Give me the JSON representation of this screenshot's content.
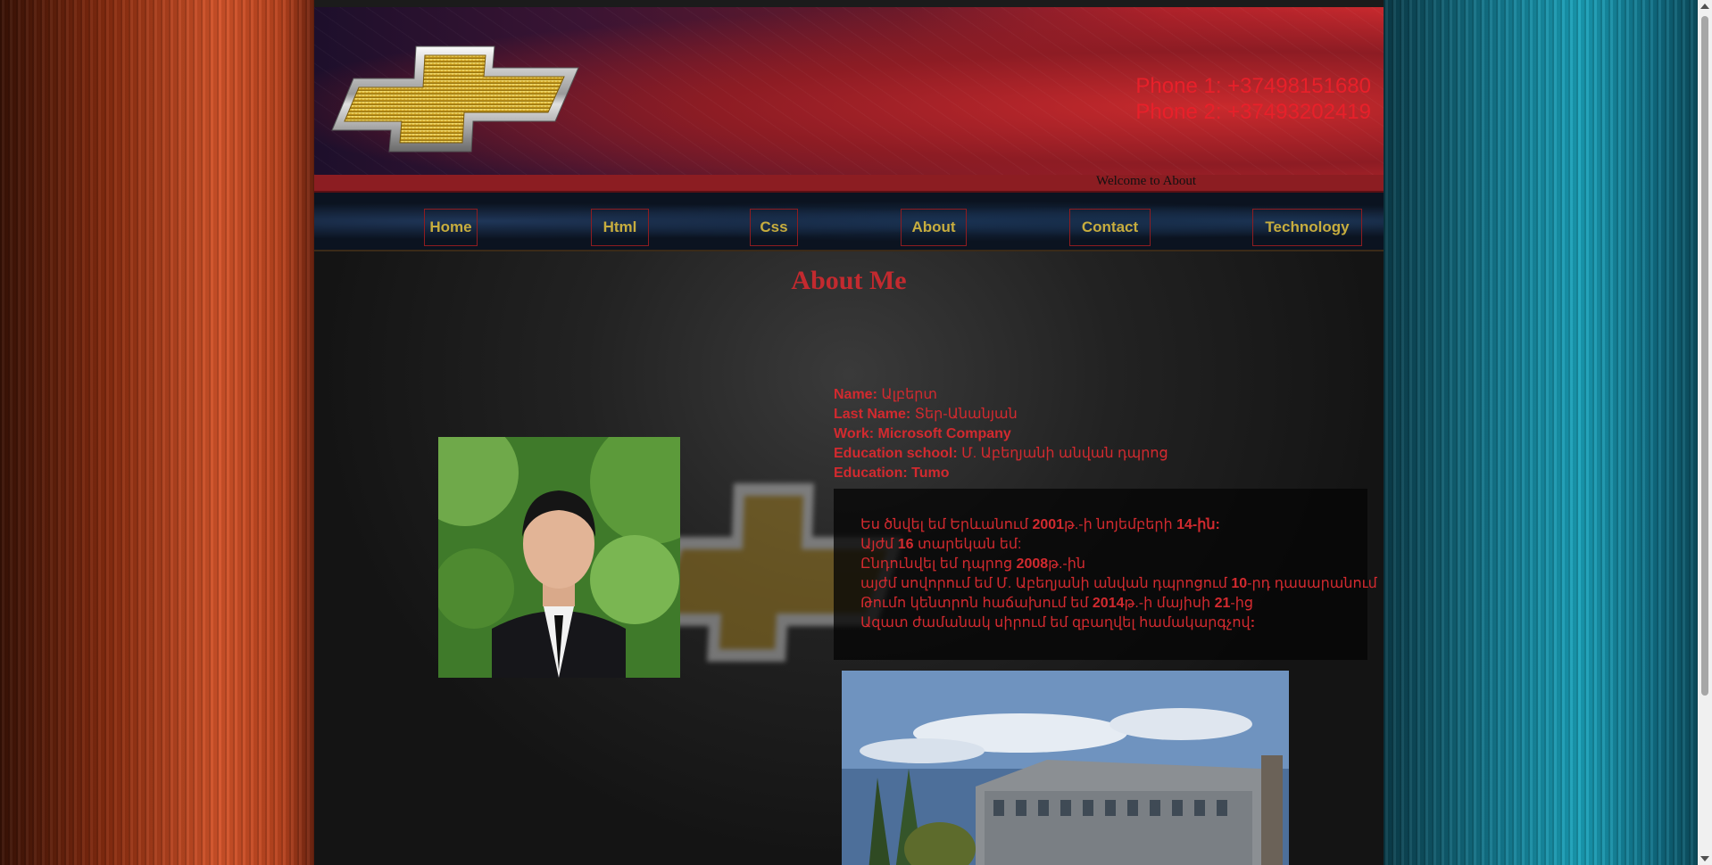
{
  "header": {
    "phone1": "Phone 1: +37498151680",
    "phone2": "Phone 2: +37493202419",
    "welcome": "Welcome to About"
  },
  "nav": {
    "items": [
      {
        "label": "Home"
      },
      {
        "label": "Html"
      },
      {
        "label": "Css"
      },
      {
        "label": "About"
      },
      {
        "label": "Contact"
      },
      {
        "label": "Technology"
      }
    ]
  },
  "main": {
    "title": "About Me",
    "info": {
      "name_label": "Name:",
      "name_value": " Ալբերտ",
      "lastname_label": "Last Name:",
      "lastname_value": " Տեր-Անանյան",
      "work_label": "Work: Microsoft Company",
      "school_label": "Education school:",
      "school_value": " Մ. Աբեղյանի անվան դպրոց",
      "education_label": "Education: Tumo"
    },
    "bio": {
      "l1_a": "Ես ծնվել եմ Երևանում ",
      "l1_b": "2001",
      "l1_c": "թ.-ի նոյեմբերի ",
      "l1_d": "14",
      "l1_e": "-ին:",
      "l2_a": "Այժմ ",
      "l2_b": "16",
      "l2_c": " տարեկան եմ:",
      "l3_a": "Ընդունվել եմ դպրոց ",
      "l3_b": "2008",
      "l3_c": "թ.-ին",
      "l4_a": "այժմ սովորում եմ Մ. Աբեղյանի անվան դպրոցում ",
      "l4_b": "10",
      "l4_c": "-րդ դասարանում",
      "l5_a": "Թումո կենտրոն հաճախում եմ ",
      "l5_b": "2014",
      "l5_c": "թ.-ի մայիսի ",
      "l5_d": "21",
      "l5_e": "-ից",
      "l6_a": "Ազատ ժամանակ սիրում եմ զբաղվել համակարգչով",
      "l6_b": ":"
    }
  },
  "colors": {
    "accent_red": "#d22a2f",
    "nav_text": "#c7ad3e",
    "header_red": "#cf2b2f"
  },
  "icons": {
    "logo": "chevrolet-bowtie-logo",
    "photo": "profile-photo",
    "building": "building-photo"
  }
}
